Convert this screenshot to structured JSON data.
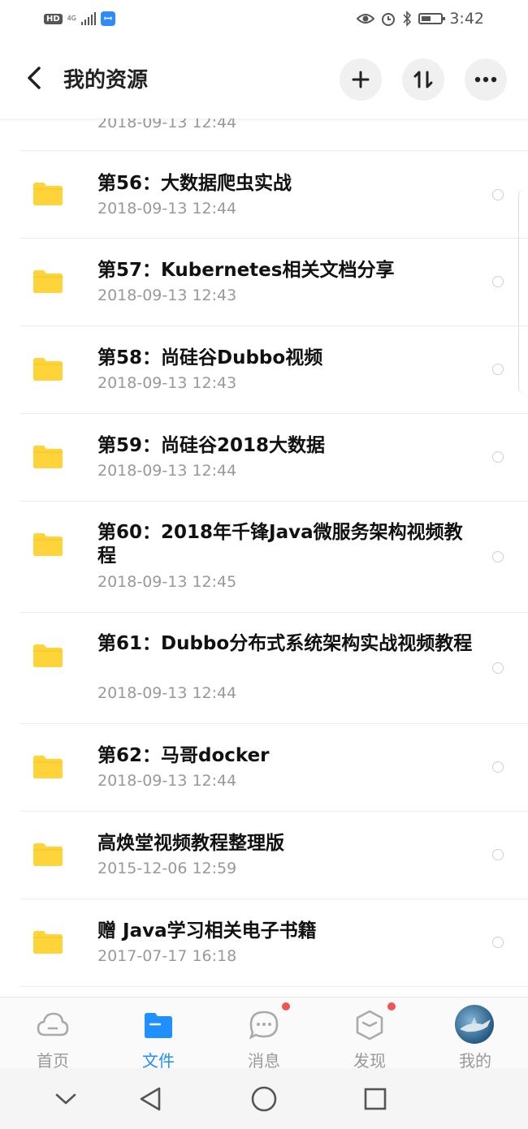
{
  "status_bar": {
    "hd": "HD",
    "network": "4G",
    "time": "3:42",
    "icons": [
      "eye-icon",
      "alarm-icon",
      "bluetooth-icon",
      "battery-icon"
    ],
    "battery_level": 0.5
  },
  "header": {
    "title": "我的资源",
    "back_icon": "chevron-left-icon",
    "actions": [
      "plus-icon",
      "sort-icon",
      "more-icon"
    ]
  },
  "files": [
    {
      "name": "第56：大数据爬虫实战",
      "date": "2018-09-13  12:44"
    },
    {
      "name": "第57：Kubernetes相关文档分享",
      "date": "2018-09-13  12:43"
    },
    {
      "name": "第58：尚硅谷Dubbo视频",
      "date": "2018-09-13  12:43"
    },
    {
      "name": "第59：尚硅谷2018大数据",
      "date": "2018-09-13  12:44"
    },
    {
      "name": "第60：2018年千锋Java微服务架构视频教程",
      "date": "2018-09-13  12:45"
    },
    {
      "name": "第61：Dubbo分布式系统架构实战视频教程",
      "date": "2018-09-13  12:44"
    },
    {
      "name": "第62：马哥docker",
      "date": "2018-09-13  12:44"
    },
    {
      "name": "高焕堂视频教程整理版",
      "date": "2015-12-06  12:59"
    },
    {
      "name": "赠 Java学习相关电子书籍",
      "date": "2017-07-17  16:18"
    }
  ],
  "partial_top_date": "2018-09-13  12:44",
  "tabs": [
    {
      "label": "首页",
      "icon": "cloud-icon",
      "active": false,
      "badge": false
    },
    {
      "label": "文件",
      "icon": "folder-icon",
      "active": true,
      "badge": false
    },
    {
      "label": "消息",
      "icon": "chat-icon",
      "active": false,
      "badge": true
    },
    {
      "label": "发现",
      "icon": "cube-icon",
      "active": false,
      "badge": true
    },
    {
      "label": "我的",
      "icon": "avatar",
      "active": false,
      "badge": false
    }
  ],
  "system_nav": [
    "chevron-down-icon",
    "back-triangle-icon",
    "home-circle-icon",
    "recents-square-icon"
  ],
  "colors": {
    "accent": "#1e90ff",
    "folder": "#ffd43b",
    "badge": "#f05555"
  }
}
